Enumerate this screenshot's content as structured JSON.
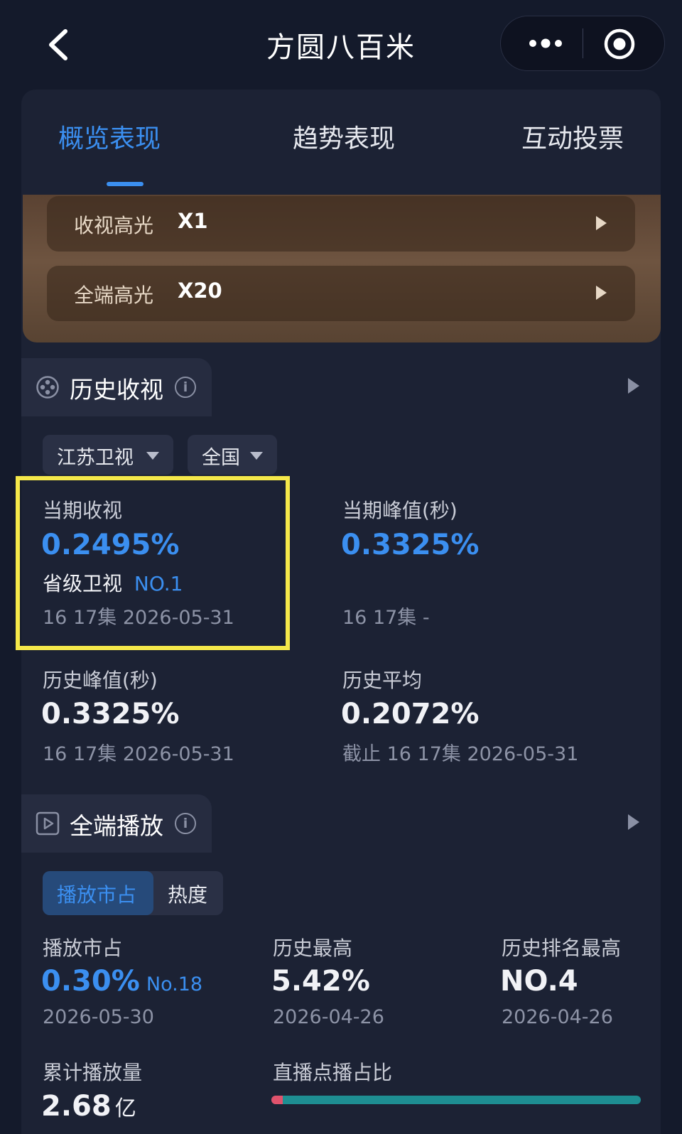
{
  "header": {
    "title": "方圆八百米"
  },
  "tabs": [
    {
      "label": "概览表现",
      "active": true
    },
    {
      "label": "趋势表现",
      "active": false
    },
    {
      "label": "互动投票",
      "active": false
    }
  ],
  "highlights": [
    {
      "label": "收视高光",
      "value": "X1"
    },
    {
      "label": "全端高光",
      "value": "X20"
    }
  ],
  "history_ratings": {
    "title": "历史收视",
    "channel": "江苏卫视",
    "region": "全国",
    "current": {
      "label": "当期收视",
      "value": "0.2495%",
      "rank_label": "省级卫视",
      "rank": "NO.1",
      "episode": "16 17集 2026-05-31"
    },
    "current_peak": {
      "label": "当期峰值(秒)",
      "value": "0.3325%",
      "episode": "16 17集 -"
    },
    "history_peak": {
      "label": "历史峰值(秒)",
      "value": "0.3325%",
      "episode": "16 17集 2026-05-31"
    },
    "history_avg": {
      "label": "历史平均",
      "value": "0.2072%",
      "episode": "截止 16 17集 2026-05-31"
    }
  },
  "all_platform": {
    "title": "全端播放",
    "toggle": [
      "播放市占",
      "热度"
    ],
    "market_share": {
      "label": "播放市占",
      "value": "0.30%",
      "rank": "No.18",
      "date": "2026-05-30"
    },
    "history_high": {
      "label": "历史最高",
      "value": "5.42%",
      "date": "2026-04-26"
    },
    "history_rank_high": {
      "label": "历史排名最高",
      "value": "NO.4",
      "date": "2026-04-26"
    },
    "cumulative": {
      "label": "累计播放量",
      "value": "2.68",
      "unit": "亿"
    },
    "live_vod_ratio": {
      "label": "直播点播占比",
      "live_fraction": 0.03
    }
  },
  "colors": {
    "accent": "#3b8ff0",
    "highlight_box": "#f5e84a",
    "vod": "#1e8e92",
    "live": "#e0526c"
  }
}
